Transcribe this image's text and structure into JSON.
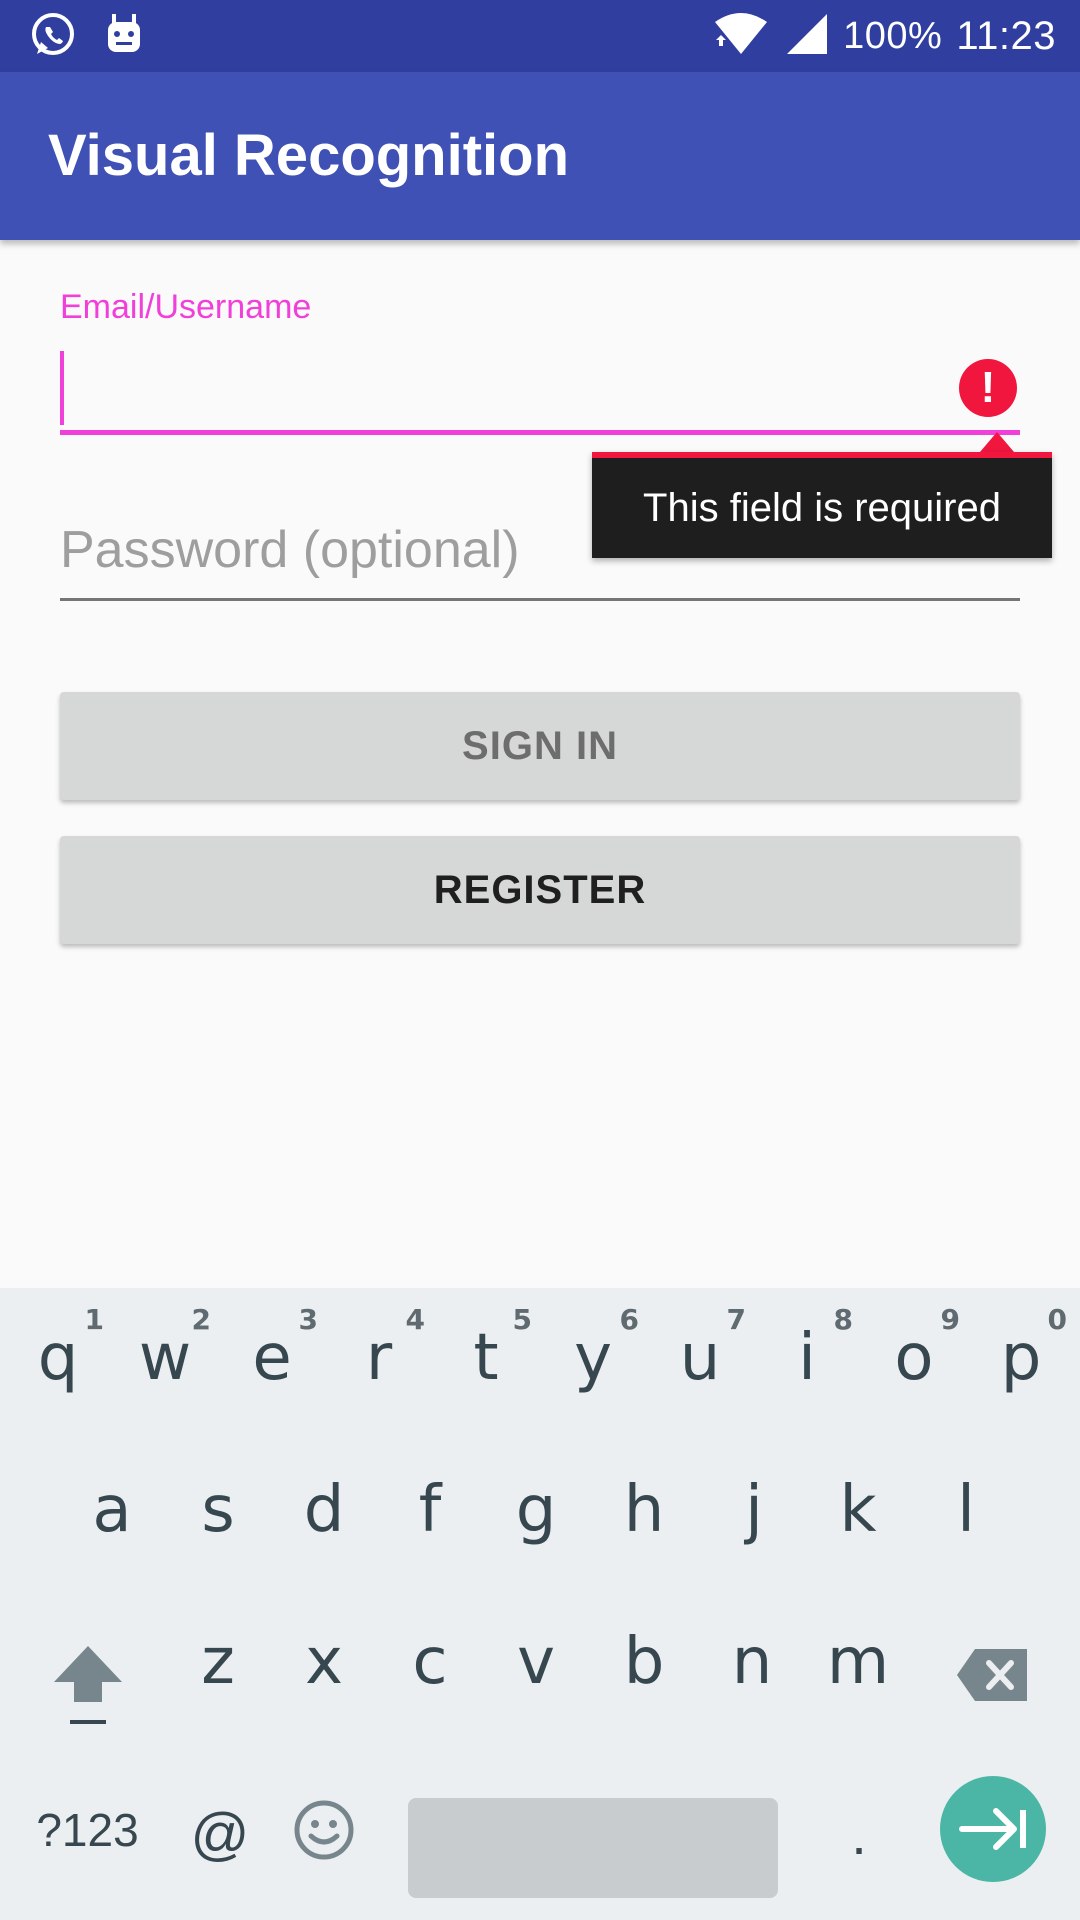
{
  "status_bar": {
    "battery": "100%",
    "time": "11:23"
  },
  "app_bar": {
    "title": "Visual Recognition"
  },
  "form": {
    "email_label": "Email/Username",
    "email_value": "",
    "error_tooltip": "This field is required",
    "password_placeholder": "Password (optional)",
    "signin_label": "SIGN IN",
    "register_label": "REGISTER"
  },
  "keyboard": {
    "row1": [
      {
        "key": "q",
        "hint": "1"
      },
      {
        "key": "w",
        "hint": "2"
      },
      {
        "key": "e",
        "hint": "3"
      },
      {
        "key": "r",
        "hint": "4"
      },
      {
        "key": "t",
        "hint": "5"
      },
      {
        "key": "y",
        "hint": "6"
      },
      {
        "key": "u",
        "hint": "7"
      },
      {
        "key": "i",
        "hint": "8"
      },
      {
        "key": "o",
        "hint": "9"
      },
      {
        "key": "p",
        "hint": "0"
      }
    ],
    "row2": [
      "a",
      "s",
      "d",
      "f",
      "g",
      "h",
      "j",
      "k",
      "l"
    ],
    "row3": [
      "z",
      "x",
      "c",
      "v",
      "b",
      "n",
      "m"
    ],
    "symbols_label": "?123",
    "at_label": "@",
    "period_label": ".",
    "icons": {
      "shift": "shift-icon",
      "backspace": "backspace-icon",
      "emoji": "emoji-icon",
      "enter": "next-field-icon"
    }
  },
  "colors": {
    "status_bar": "#303f9f",
    "app_bar": "#3f51b5",
    "accent": "#f140d9",
    "error": "#f0163e",
    "enter_key": "#4cb6a6"
  }
}
